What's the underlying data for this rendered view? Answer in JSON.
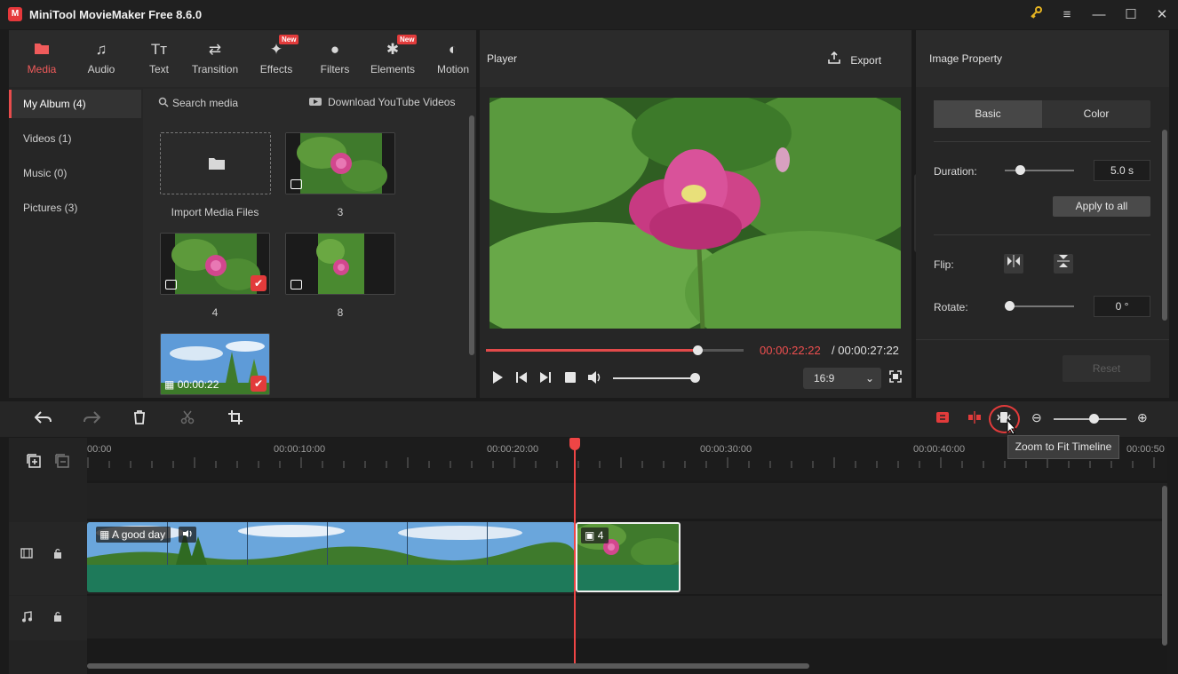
{
  "window": {
    "title": "MiniTool MovieMaker Free 8.6.0",
    "logo_letter": "M",
    "key_icon": "key-icon",
    "menu_icon": "hamburger-menu-icon",
    "minimize": "—",
    "maximize": "☐",
    "close": "✕"
  },
  "tabs": [
    {
      "label": "Media",
      "icon": "▬",
      "active": true,
      "new": false
    },
    {
      "label": "Audio",
      "icon": "♫",
      "new": false
    },
    {
      "label": "Text",
      "icon": "Tт",
      "new": false
    },
    {
      "label": "Transition",
      "icon": "⇄",
      "new": false
    },
    {
      "label": "Effects",
      "icon": "✦",
      "new": true,
      "badge": "New"
    },
    {
      "label": "Filters",
      "icon": "●",
      "new": false
    },
    {
      "label": "Elements",
      "icon": "✱",
      "new": true,
      "badge": "New"
    },
    {
      "label": "Motion",
      "icon": "◐",
      "new": false
    }
  ],
  "album": [
    {
      "label": "My Album (4)",
      "active": true
    },
    {
      "label": "Videos (1)"
    },
    {
      "label": "Music (0)"
    },
    {
      "label": "Pictures (3)"
    }
  ],
  "media": {
    "search_placeholder": "Search media",
    "download_label": "Download YouTube Videos",
    "import_label": "Import Media Files",
    "items": [
      {
        "label": "3",
        "type": "image",
        "checked": false
      },
      {
        "label": "4",
        "type": "image",
        "checked": true
      },
      {
        "label": "8",
        "type": "image",
        "checked": false
      },
      {
        "label": "",
        "type": "video",
        "duration": "00:00:22",
        "checked": true
      }
    ],
    "check_mark": "✔"
  },
  "player": {
    "title": "Player",
    "export_label": "Export",
    "time_current": "00:00:22:22",
    "time_total": "/ 00:00:27:22",
    "progress": 0.82,
    "volume": 0.95,
    "aspect": "16:9"
  },
  "property": {
    "title": "Image Property",
    "tab_basic": "Basic",
    "tab_color": "Color",
    "duration_label": "Duration:",
    "duration_value": "5.0 s",
    "apply_all": "Apply to all",
    "flip_label": "Flip:",
    "rotate_label": "Rotate:",
    "rotate_value": "0 °",
    "reset": "Reset"
  },
  "timeline": {
    "ticks": [
      "00:00",
      "00:00:10:00",
      "00:00:20:00",
      "00:00:30:00",
      "00:00:40:00",
      "00:00:50"
    ],
    "video_clip_label": "A good day",
    "image_clip_label": "4",
    "tooltip": "Zoom to Fit Timeline",
    "zoom_level": 0.55
  },
  "colors": {
    "accent": "#e23b3b",
    "clip": "#1e7a5a",
    "playhead": "#ef4545"
  }
}
